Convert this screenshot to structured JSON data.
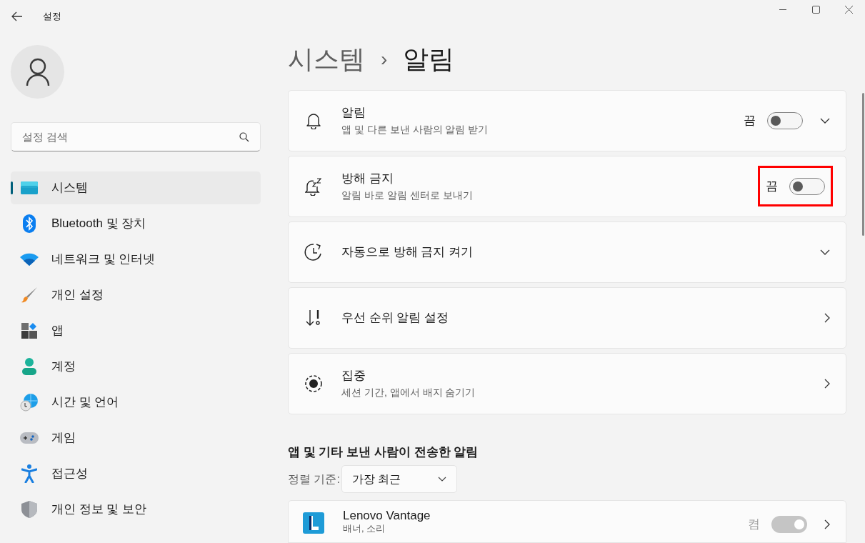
{
  "window": {
    "title": "설정"
  },
  "sidebar": {
    "search": {
      "placeholder": "설정 검색"
    },
    "items": [
      {
        "label": "시스템",
        "selected": true
      },
      {
        "label": "Bluetooth 및 장치",
        "selected": false
      },
      {
        "label": "네트워크 및 인터넷",
        "selected": false
      },
      {
        "label": "개인 설정",
        "selected": false
      },
      {
        "label": "앱",
        "selected": false
      },
      {
        "label": "계정",
        "selected": false
      },
      {
        "label": "시간 및 언어",
        "selected": false
      },
      {
        "label": "게임",
        "selected": false
      },
      {
        "label": "접근성",
        "selected": false
      },
      {
        "label": "개인 정보 및 보안",
        "selected": false
      }
    ]
  },
  "breadcrumb": {
    "parent": "시스템",
    "separator": "›",
    "current": "알림"
  },
  "settings": [
    {
      "kind": "toggle",
      "title": "알림",
      "subtitle": "앱 및 다른 보낸 사람의 알림 받기",
      "state_label": "끔",
      "on": false,
      "expander": true,
      "highlighted": false
    },
    {
      "kind": "toggle",
      "title": "방해 금지",
      "subtitle": "알림 바로 알림 센터로 보내기",
      "state_label": "끔",
      "on": false,
      "expander": false,
      "highlighted": true
    },
    {
      "kind": "expand",
      "title": "자동으로 방해 금지 켜기"
    },
    {
      "kind": "link",
      "title": "우선 순위 알림 설정"
    },
    {
      "kind": "link",
      "title": "집중",
      "subtitle": "세션 기간, 앱에서 배지 숨기기"
    }
  ],
  "apps_section": {
    "heading": "앱 및 기타 보낸 사람이 전송한 알림",
    "sort_label": "정렬 기준:",
    "sort_value": "가장 최근",
    "apps": [
      {
        "name": "Lenovo Vantage",
        "subtitle": "배너, 소리",
        "state_label": "켬",
        "on": true,
        "disabled": true
      }
    ]
  }
}
